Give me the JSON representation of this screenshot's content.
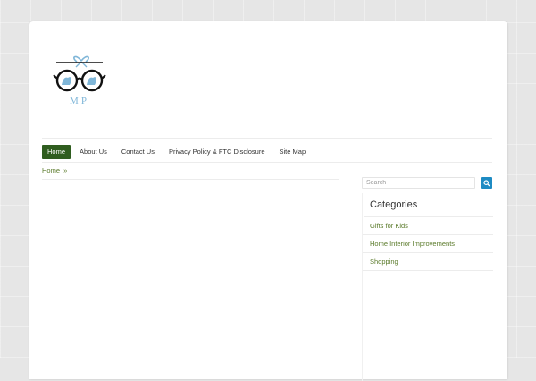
{
  "logo": {
    "text": "MP"
  },
  "nav": {
    "items": [
      {
        "label": "Home"
      },
      {
        "label": "About Us"
      },
      {
        "label": "Contact Us"
      },
      {
        "label": "Privacy Policy & FTC Disclosure"
      },
      {
        "label": "Site Map"
      }
    ]
  },
  "breadcrumb": {
    "home": "Home",
    "separator": "»"
  },
  "search": {
    "placeholder": "Search"
  },
  "sidebar": {
    "title": "Categories",
    "categories": [
      "Gifts for Kids",
      "Home Interior Improvements",
      "Shopping"
    ]
  },
  "colors": {
    "nav_active": "#2f5d1f",
    "link": "#5a7a2a",
    "search_button": "#1e8bc3"
  }
}
